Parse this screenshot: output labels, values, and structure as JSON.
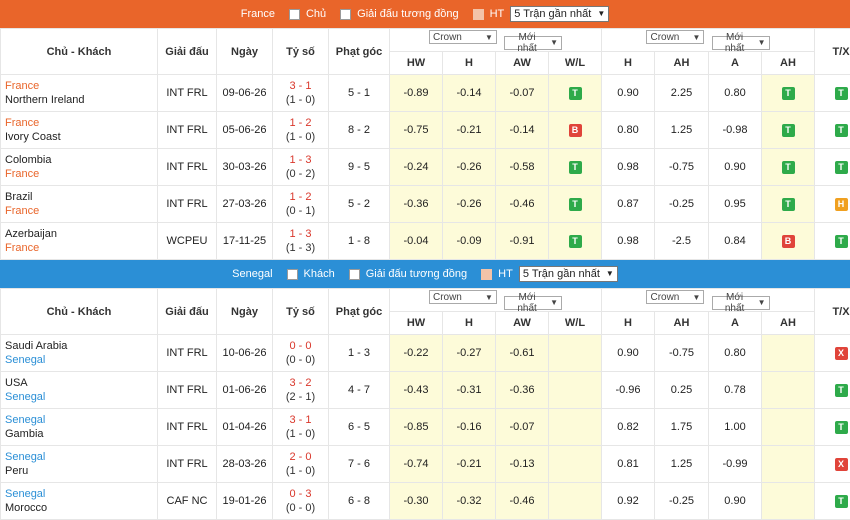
{
  "sections": [
    {
      "theme": "orange",
      "filter": {
        "team": "France",
        "opt1": "Chủ",
        "opt2": "Giải đấu tương đồng",
        "opt3": "HT",
        "select": "5 Trận gần nhất"
      },
      "headers": {
        "teams": "Chủ - Khách",
        "league": "Giải đấu",
        "date": "Ngày",
        "score": "Tỷ số",
        "corner": "Phạt góc",
        "sel1": "Crown",
        "sel2": "Mới nhất",
        "sel3": "Crown",
        "sel4": "Mới nhất",
        "tx": "T/X",
        "hw": "HW",
        "h": "H",
        "aw": "AW",
        "wl": "W/L",
        "h2": "H",
        "ah": "AH",
        "a": "A",
        "ah2": "AH"
      },
      "rows": [
        {
          "home": "France",
          "away": "Northern Ireland",
          "hl": "home",
          "league": "INT FRL",
          "date": "09-06-26",
          "ft": "3 - 1",
          "ht": "(1 - 0)",
          "corner": "5 - 1",
          "hw": "-0.89",
          "h": "-0.14",
          "aw": "-0.07",
          "wl": "T",
          "h2": "0.90",
          "ah": "2.25",
          "a": "0.80",
          "ah_r": "T",
          "tx": "T"
        },
        {
          "home": "France",
          "away": "Ivory Coast",
          "hl": "home",
          "league": "INT FRL",
          "date": "05-06-26",
          "ft": "1 - 2",
          "ht": "(1 - 0)",
          "corner": "8 - 2",
          "hw": "-0.75",
          "h": "-0.21",
          "aw": "-0.14",
          "wl": "B",
          "h2": "0.80",
          "ah": "1.25",
          "a": "-0.98",
          "ah_r": "T",
          "tx": "T"
        },
        {
          "home": "Colombia",
          "away": "France",
          "hl": "away",
          "league": "INT FRL",
          "date": "30-03-26",
          "ft": "1 - 3",
          "ht": "(0 - 2)",
          "corner": "9 - 5",
          "hw": "-0.24",
          "h": "-0.26",
          "aw": "-0.58",
          "wl": "T",
          "h2": "0.98",
          "ah": "-0.75",
          "a": "0.90",
          "ah_r": "T",
          "tx": "T"
        },
        {
          "home": "Brazil",
          "away": "France",
          "hl": "away",
          "league": "INT FRL",
          "date": "27-03-26",
          "ft": "1 - 2",
          "ht": "(0 - 1)",
          "corner": "5 - 2",
          "hw": "-0.36",
          "h": "-0.26",
          "aw": "-0.46",
          "wl": "T",
          "h2": "0.87",
          "ah": "-0.25",
          "a": "0.95",
          "ah_r": "T",
          "tx": "H"
        },
        {
          "home": "Azerbaijan",
          "away": "France",
          "hl": "away",
          "league": "WCPEU",
          "date": "17-11-25",
          "ft": "1 - 3",
          "ht": "(1 - 3)",
          "corner": "1 - 8",
          "hw": "-0.04",
          "h": "-0.09",
          "aw": "-0.91",
          "wl": "T",
          "h2": "0.98",
          "ah": "-2.5",
          "a": "0.84",
          "ah_r": "B",
          "tx": "T"
        }
      ]
    },
    {
      "theme": "blue",
      "filter": {
        "team": "Senegal",
        "opt1": "Khách",
        "opt2": "Giải đấu tương đồng",
        "opt3": "HT",
        "select": "5 Trận gần nhất"
      },
      "headers": {
        "teams": "Chủ - Khách",
        "league": "Giải đấu",
        "date": "Ngày",
        "score": "Tỷ số",
        "corner": "Phạt góc",
        "sel1": "Crown",
        "sel2": "Mới nhất",
        "sel3": "Crown",
        "sel4": "Mới nhất",
        "tx": "T/X",
        "hw": "HW",
        "h": "H",
        "aw": "AW",
        "wl": "W/L",
        "h2": "H",
        "ah": "AH",
        "a": "A",
        "ah2": "AH"
      },
      "rows": [
        {
          "home": "Saudi Arabia",
          "away": "Senegal",
          "hl": "away",
          "league": "INT FRL",
          "date": "10-06-26",
          "ft": "0 - 0",
          "ht": "(0 - 0)",
          "corner": "1 - 3",
          "hw": "-0.22",
          "h": "-0.27",
          "aw": "-0.61",
          "wl": "",
          "h2": "0.90",
          "ah": "-0.75",
          "a": "0.80",
          "ah_r": "",
          "tx": "X"
        },
        {
          "home": "USA",
          "away": "Senegal",
          "hl": "away",
          "league": "INT FRL",
          "date": "01-06-26",
          "ft": "3 - 2",
          "ht": "(2 - 1)",
          "corner": "4 - 7",
          "hw": "-0.43",
          "h": "-0.31",
          "aw": "-0.36",
          "wl": "",
          "h2": "-0.96",
          "ah": "0.25",
          "a": "0.78",
          "ah_r": "",
          "tx": "T"
        },
        {
          "home": "Senegal",
          "away": "Gambia",
          "hl": "home",
          "league": "INT FRL",
          "date": "01-04-26",
          "ft": "3 - 1",
          "ht": "(1 - 0)",
          "corner": "6 - 5",
          "hw": "-0.85",
          "h": "-0.16",
          "aw": "-0.07",
          "wl": "",
          "h2": "0.82",
          "ah": "1.75",
          "a": "1.00",
          "ah_r": "",
          "tx": "T"
        },
        {
          "home": "Senegal",
          "away": "Peru",
          "hl": "home",
          "league": "INT FRL",
          "date": "28-03-26",
          "ft": "2 - 0",
          "ht": "(1 - 0)",
          "corner": "7 - 6",
          "hw": "-0.74",
          "h": "-0.21",
          "aw": "-0.13",
          "wl": "",
          "h2": "0.81",
          "ah": "1.25",
          "a": "-0.99",
          "ah_r": "",
          "tx": "X"
        },
        {
          "home": "Senegal",
          "away": "Morocco",
          "hl": "home",
          "league": "CAF NC",
          "date": "19-01-26",
          "ft": "0 - 3",
          "ht": "(0 - 0)",
          "corner": "6 - 8",
          "hw": "-0.30",
          "h": "-0.32",
          "aw": "-0.46",
          "wl": "",
          "h2": "0.92",
          "ah": "-0.25",
          "a": "0.90",
          "ah_r": "",
          "tx": "T"
        }
      ]
    }
  ],
  "colors": {
    "orange": "#e9652a",
    "blue": "#2b8fd6",
    "win": "#2eaa4a",
    "lose": "#e0443a",
    "half": "#f0a020",
    "odds_bg": "#fdfbd9"
  }
}
